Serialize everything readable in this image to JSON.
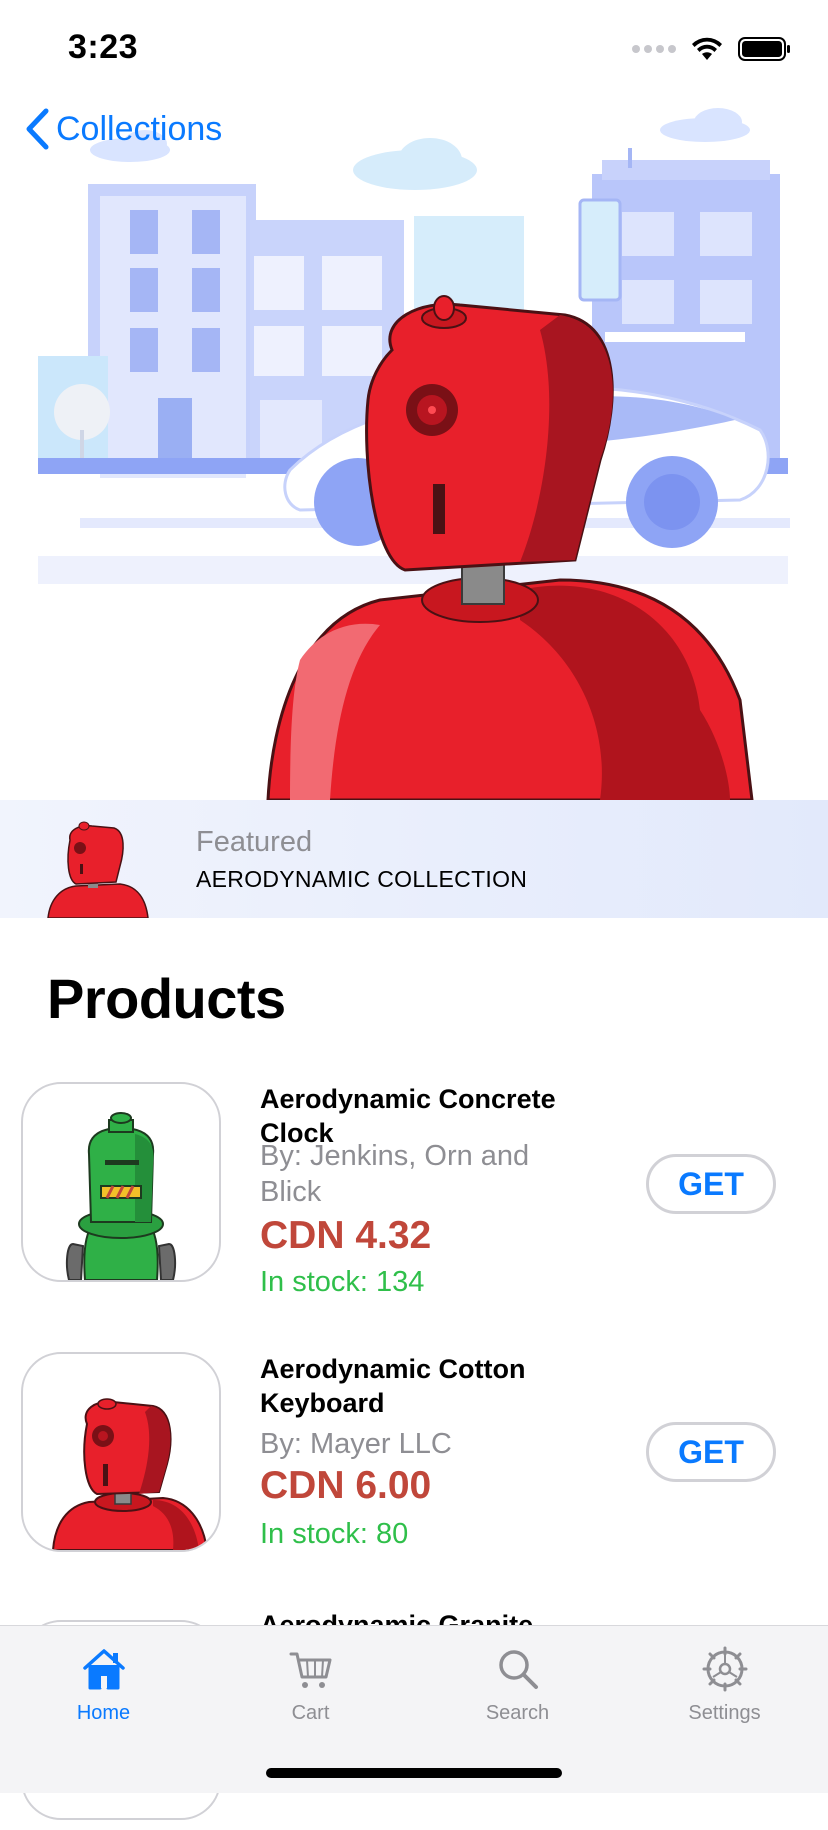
{
  "status_bar": {
    "time": "3:23"
  },
  "nav": {
    "back_label": "Collections"
  },
  "featured": {
    "label": "Featured",
    "title": "AERODYNAMIC COLLECTION"
  },
  "products_section": {
    "title": "Products"
  },
  "products": [
    {
      "name": "Aerodynamic Concrete Clock",
      "vendor": "By: Jenkins, Orn and Blick",
      "price": "CDN 4.32",
      "stock": "In stock: 134",
      "button": "GET",
      "thumb": "green-robot"
    },
    {
      "name": "Aerodynamic Cotton Keyboard",
      "vendor": "By: Mayer LLC",
      "price": "CDN 6.00",
      "stock": "In stock: 80",
      "button": "GET",
      "thumb": "red-robot"
    },
    {
      "name": "Aerodynamic Granite",
      "thumb": "robot"
    }
  ],
  "tabs": [
    {
      "label": "Home",
      "icon": "house-icon",
      "active": true
    },
    {
      "label": "Cart",
      "icon": "cart-icon",
      "active": false
    },
    {
      "label": "Search",
      "icon": "magnifier-icon",
      "active": false
    },
    {
      "label": "Settings",
      "icon": "gear-icon",
      "active": false
    }
  ],
  "colors": {
    "accent": "#0a7aff",
    "price": "#c0473a",
    "stock": "#2fbf4a",
    "robot_red": "#e8202b",
    "robot_green": "#2fb047"
  }
}
